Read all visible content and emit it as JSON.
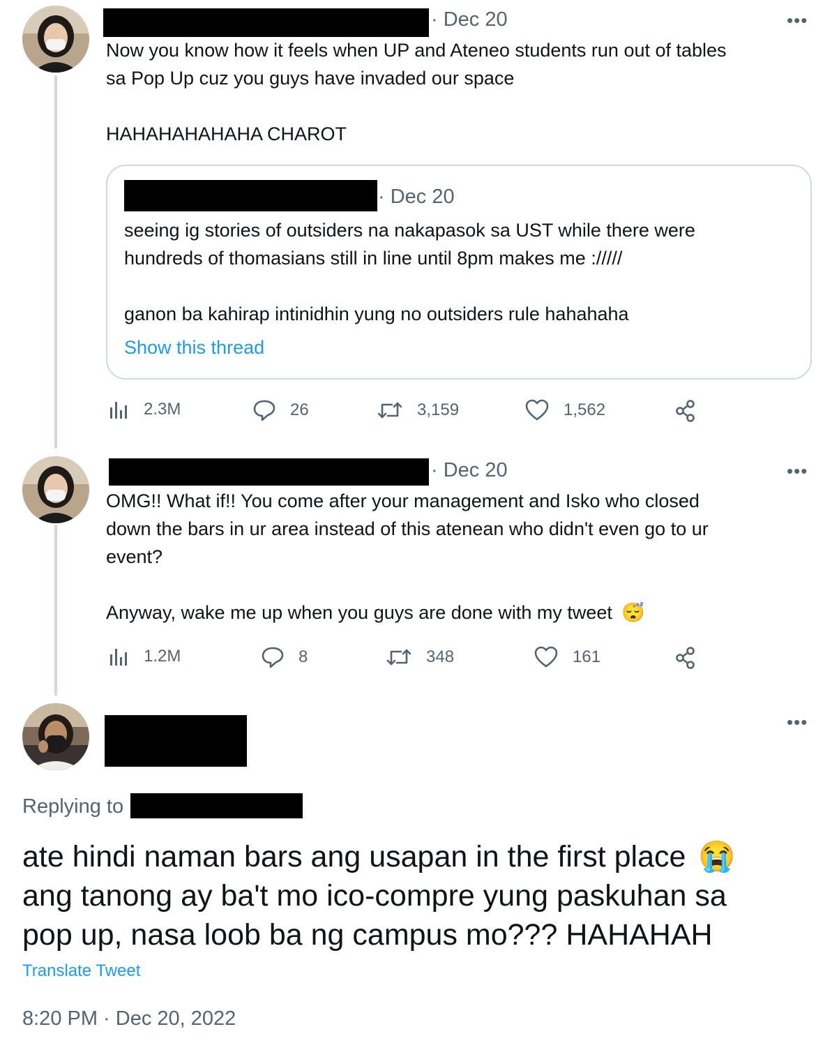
{
  "tweet1": {
    "date": "· Dec 20",
    "text_line1": "Now you know how it feels when UP and Ateneo students run out of tables",
    "text_line2": "sa Pop Up cuz you guys have invaded our space",
    "text_line3": "HAHAHAHAHAHA CHAROT",
    "quote": {
      "date": "· Dec 20",
      "text_line1": "seeing ig stories of outsiders na nakapasok sa UST while there were",
      "text_line2": "hundreds of thomasians still in line until 8pm makes me ://///",
      "text_line3": "ganon ba kahirap intinidhin yung no outsiders rule hahahaha",
      "show_thread": "Show this thread"
    },
    "views": "2.3M",
    "replies": "26",
    "retweets": "3,159",
    "likes": "1,562"
  },
  "tweet2": {
    "date": "· Dec 20",
    "text_line1": "OMG!! What if!! You come after your management and Isko who closed",
    "text_line2": "down the bars in ur area instead of this atenean who didn't even go to ur",
    "text_line3": "event?",
    "text_line4": "Anyway, wake me up when you guys are done with my tweet",
    "emoji": "😴",
    "views": "1.2M",
    "replies": "8",
    "retweets": "348",
    "likes": "161"
  },
  "main_tweet": {
    "replying_to_label": "Replying to",
    "text_line1": "ate hindi naman bars ang usapan in the first place",
    "emoji": "😭",
    "text_line2": "ang tanong ay ba't mo ico-compre yung paskuhan sa",
    "text_line3": "pop up, nasa loob ba ng campus mo??? HAHAHAH",
    "translate": "Translate Tweet",
    "timestamp": "8:20 PM · Dec 20, 2022"
  },
  "more_label": "•••",
  "colors": {
    "text": "#0f1419",
    "secondary": "#536471",
    "link": "#1d9bf0",
    "border": "#cfd9de"
  }
}
